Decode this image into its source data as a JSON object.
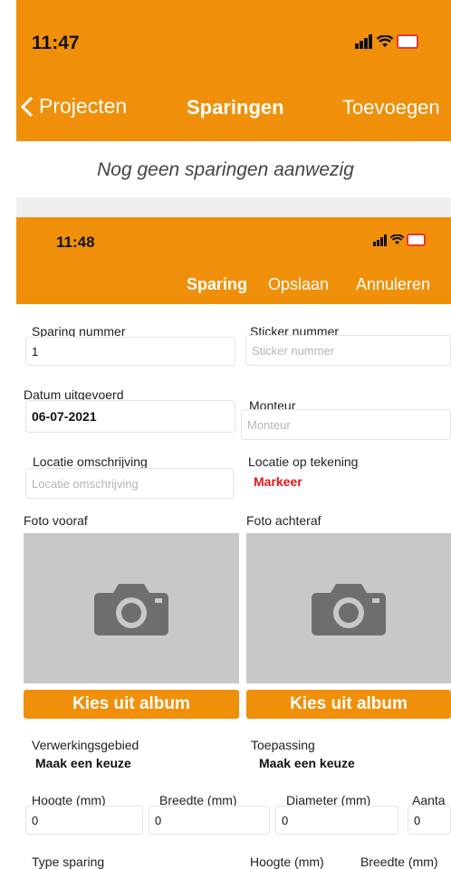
{
  "screen1": {
    "status_time": "11:47",
    "nav_back_label": "Projecten",
    "nav_title": "Sparingen",
    "nav_add_label": "Toevoegen",
    "empty_message": "Nog geen sparingen aanwezig"
  },
  "screen2": {
    "status_time": "11:48",
    "header_title": "Sparing",
    "save_label": "Opslaan",
    "cancel_label": "Annuleren",
    "fields": {
      "sparing_nummer": {
        "label": "Sparing nummer",
        "value": "1"
      },
      "sticker_nummer": {
        "label": "Sticker nummer",
        "placeholder": "Sticker nummer"
      },
      "datum": {
        "label": "Datum uitgevoerd",
        "value": "06-07-2021"
      },
      "monteur": {
        "label": "Monteur",
        "placeholder": "Monteur"
      },
      "locatie_omschrijving": {
        "label": "Locatie omschrijving",
        "placeholder": "Locatie omschrijving"
      },
      "locatie_tekening": {
        "label": "Locatie op tekening",
        "action": "Markeer"
      },
      "foto_vooraf": {
        "label": "Foto vooraf",
        "button": "Kies uit album"
      },
      "foto_achteraf": {
        "label": "Foto achteraf",
        "button": "Kies uit album"
      },
      "verwerkingsgebied": {
        "label": "Verwerkingsgebied",
        "value": "Maak een keuze"
      },
      "toepassing": {
        "label": "Toepassing",
        "value": "Maak een keuze"
      },
      "hoogte": {
        "label": "Hoogte (mm)",
        "value": "0"
      },
      "breedte": {
        "label": "Breedte (mm)",
        "value": "0"
      },
      "diameter": {
        "label": "Diameter (mm)",
        "value": "0"
      },
      "aantal": {
        "label": "Aanta",
        "value": "0"
      },
      "type_sparing": {
        "label": "Type sparing"
      },
      "hoogte2": {
        "label": "Hoogte (mm)"
      },
      "breedte2": {
        "label": "Breedte (mm)"
      }
    }
  },
  "icons": [
    "signal-icon",
    "wifi-icon",
    "battery-icon",
    "chevron-left-icon",
    "camera-icon"
  ],
  "colors": {
    "accent": "#f0900a",
    "warning": "#e21818",
    "photo_bg": "#c8c8c8"
  }
}
